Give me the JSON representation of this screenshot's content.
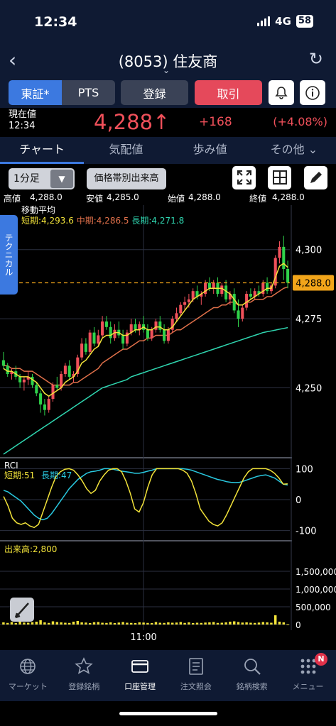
{
  "status": {
    "time": "12:34",
    "network": "4G",
    "battery": "58"
  },
  "header": {
    "title": "(8053) 住友商"
  },
  "actions": {
    "tosho": "東証*",
    "pts": "PTS",
    "register": "登録",
    "trade": "取引"
  },
  "quote": {
    "label": "現在値",
    "time": "12:34",
    "price": "4,288",
    "arrow": "↑",
    "change": "+168",
    "pct": "(+4.08%)"
  },
  "tabs": [
    "チャート",
    "気配値",
    "歩み値",
    "その他 ⌄"
  ],
  "toolbar": {
    "interval": "1分足",
    "price_band": "価格帯別出来高"
  },
  "ohlc": {
    "high_label": "高値",
    "high": "4,288.0",
    "low_label": "安値",
    "low": "4,285.0",
    "open_label": "始値",
    "open": "4,288.0",
    "close_label": "終値",
    "close": "4,288.0"
  },
  "ma": {
    "title": "移動平均",
    "short": "短期:4,293.6",
    "mid": "中期:4,286.5",
    "long": "長期:4,271.8"
  },
  "technical_label": "テクニカル",
  "rci": {
    "title": "RCI",
    "short": "短期:51",
    "long": "長期:47"
  },
  "volume": {
    "title": "出来高:2,800"
  },
  "colors": {
    "up": "#f0505a",
    "down": "#2fd24a",
    "ma_short": "#f2e33a",
    "ma_mid": "#e0704a",
    "ma_long": "#2fd6b0",
    "accent": "#3c79e0"
  },
  "chart_data": [
    {
      "type": "candlestick",
      "title": "",
      "y_ticks": [
        4300,
        4275,
        4250
      ],
      "ylim": [
        4226,
        4312
      ],
      "current_price_line": 4288.0,
      "current_price_label": "4,288.0",
      "x_tick_labels": [
        "11:00"
      ],
      "candles": [
        [
          4260,
          4263,
          4257,
          4258
        ],
        [
          4258,
          4259,
          4254,
          4255
        ],
        [
          4255,
          4257,
          4253,
          4256
        ],
        [
          4256,
          4258,
          4253,
          4254
        ],
        [
          4254,
          4255,
          4250,
          4252
        ],
        [
          4252,
          4254,
          4249,
          4253
        ],
        [
          4253,
          4256,
          4251,
          4254
        ],
        [
          4254,
          4255,
          4250,
          4251
        ],
        [
          4251,
          4252,
          4247,
          4248
        ],
        [
          4248,
          4249,
          4241,
          4244
        ],
        [
          4244,
          4246,
          4240,
          4242
        ],
        [
          4242,
          4247,
          4241,
          4246
        ],
        [
          4246,
          4252,
          4245,
          4251
        ],
        [
          4251,
          4254,
          4249,
          4250
        ],
        [
          4250,
          4256,
          4249,
          4255
        ],
        [
          4255,
          4259,
          4254,
          4258
        ],
        [
          4258,
          4260,
          4253,
          4254
        ],
        [
          4254,
          4256,
          4252,
          4255
        ],
        [
          4255,
          4262,
          4254,
          4261
        ],
        [
          4261,
          4268,
          4260,
          4266
        ],
        [
          4266,
          4268,
          4262,
          4263
        ],
        [
          4263,
          4271,
          4262,
          4270
        ],
        [
          4270,
          4272,
          4265,
          4266
        ],
        [
          4266,
          4271,
          4265,
          4269
        ],
        [
          4269,
          4276,
          4268,
          4274
        ],
        [
          4274,
          4276,
          4271,
          4272
        ],
        [
          4272,
          4274,
          4266,
          4268
        ],
        [
          4268,
          4273,
          4267,
          4271
        ],
        [
          4271,
          4274,
          4268,
          4269
        ],
        [
          4269,
          4271,
          4264,
          4266
        ],
        [
          4266,
          4271,
          4265,
          4270
        ],
        [
          4270,
          4275,
          4269,
          4273
        ],
        [
          4273,
          4275,
          4270,
          4271
        ],
        [
          4271,
          4274,
          4269,
          4273
        ],
        [
          4273,
          4276,
          4270,
          4271
        ],
        [
          4271,
          4273,
          4267,
          4268
        ],
        [
          4268,
          4272,
          4267,
          4271
        ],
        [
          4271,
          4275,
          4270,
          4274
        ],
        [
          4274,
          4276,
          4270,
          4271
        ],
        [
          4271,
          4273,
          4266,
          4267
        ],
        [
          4267,
          4272,
          4266,
          4271
        ],
        [
          4271,
          4276,
          4270,
          4275
        ],
        [
          4275,
          4279,
          4274,
          4277
        ],
        [
          4277,
          4281,
          4276,
          4280
        ],
        [
          4280,
          4283,
          4278,
          4281
        ],
        [
          4281,
          4284,
          4279,
          4282
        ],
        [
          4282,
          4286,
          4281,
          4285
        ],
        [
          4285,
          4287,
          4282,
          4283
        ],
        [
          4283,
          4285,
          4280,
          4284
        ],
        [
          4284,
          4289,
          4283,
          4288
        ],
        [
          4288,
          4290,
          4285,
          4286
        ],
        [
          4286,
          4289,
          4284,
          4288
        ],
        [
          4288,
          4290,
          4283,
          4284
        ],
        [
          4284,
          4288,
          4283,
          4287
        ],
        [
          4287,
          4289,
          4281,
          4282
        ],
        [
          4282,
          4285,
          4280,
          4284
        ],
        [
          4284,
          4286,
          4277,
          4278
        ],
        [
          4278,
          4282,
          4272,
          4275
        ],
        [
          4275,
          4280,
          4274,
          4279
        ],
        [
          4279,
          4285,
          4278,
          4284
        ],
        [
          4284,
          4286,
          4282,
          4283
        ],
        [
          4283,
          4286,
          4282,
          4285
        ],
        [
          4285,
          4287,
          4283,
          4284
        ],
        [
          4284,
          4289,
          4283,
          4288
        ],
        [
          4288,
          4290,
          4284,
          4285
        ],
        [
          4285,
          4288,
          4284,
          4287
        ],
        [
          4287,
          4298,
          4286,
          4297
        ],
        [
          4297,
          4303,
          4295,
          4301
        ],
        [
          4301,
          4305,
          4289,
          4293
        ],
        [
          4293,
          4296,
          4286,
          4288
        ]
      ],
      "ma_short": [
        4257,
        4256,
        4256,
        4255,
        4254,
        4254,
        4254,
        4253,
        4252,
        4250,
        4248,
        4247,
        4248,
        4249,
        4250,
        4252,
        4253,
        4254,
        4256,
        4259,
        4260,
        4262,
        4264,
        4265,
        4268,
        4269,
        4269,
        4270,
        4270,
        4269,
        4269,
        4270,
        4271,
        4271,
        4272,
        4271,
        4271,
        4272,
        4272,
        4271,
        4271,
        4272,
        4274,
        4276,
        4278,
        4280,
        4282,
        4283,
        4284,
        4285,
        4286,
        4286,
        4286,
        4286,
        4285,
        4284,
        4282,
        4280,
        4280,
        4281,
        4282,
        4283,
        4284,
        4285,
        4286,
        4286,
        4290,
        4294,
        4295,
        4293.6
      ],
      "ma_mid": [
        4258,
        4258,
        4257,
        4257,
        4257,
        4256,
        4256,
        4256,
        4255,
        4254,
        4253,
        4252,
        4251,
        4251,
        4251,
        4251,
        4251,
        4252,
        4252,
        4253,
        4254,
        4255,
        4256,
        4257,
        4259,
        4260,
        4261,
        4262,
        4263,
        4264,
        4264,
        4265,
        4266,
        4267,
        4267,
        4268,
        4268,
        4269,
        4269,
        4269,
        4269,
        4270,
        4271,
        4271,
        4272,
        4273,
        4274,
        4275,
        4276,
        4277,
        4278,
        4279,
        4279,
        4280,
        4280,
        4281,
        4281,
        4280,
        4280,
        4281,
        4281,
        4282,
        4282,
        4282,
        4283,
        4283,
        4284,
        4285,
        4286,
        4286.5
      ],
      "ma_long": [
        4226,
        4227,
        4228,
        4229,
        4230,
        4231,
        4232,
        4233,
        4234,
        4235,
        4236,
        4237,
        4238,
        4239,
        4240,
        4241,
        4242,
        4243,
        4244,
        4245,
        4246,
        4247,
        4248,
        4249,
        4250,
        4250.5,
        4251,
        4251.5,
        4252,
        4252.5,
        4253,
        4254,
        4254.5,
        4255,
        4255.5,
        4256,
        4256.5,
        4257,
        4257.5,
        4258,
        4258.5,
        4259,
        4259.5,
        4260,
        4260.5,
        4261,
        4261.5,
        4262,
        4262.5,
        4263,
        4263.5,
        4264,
        4264.5,
        4265,
        4265.5,
        4266,
        4266.5,
        4267,
        4267.5,
        4268,
        4268.5,
        4269,
        4269.5,
        4270,
        4270.3,
        4270.6,
        4270.9,
        4271.2,
        4271.5,
        4271.8
      ]
    },
    {
      "type": "line",
      "title": "RCI",
      "y_ticks": [
        100,
        0,
        -100
      ],
      "ylim": [
        -110,
        110
      ],
      "series": [
        {
          "name": "短期",
          "values": [
            10,
            -20,
            -60,
            -75,
            -80,
            -75,
            -85,
            -90,
            -80,
            -40,
            0,
            40,
            75,
            90,
            98,
            100,
            95,
            80,
            60,
            35,
            20,
            30,
            60,
            80,
            95,
            100,
            100,
            90,
            60,
            20,
            -30,
            -40,
            -10,
            40,
            80,
            100,
            100,
            100,
            100,
            100,
            100,
            95,
            85,
            60,
            20,
            -30,
            -50,
            -70,
            -80,
            -85,
            -75,
            -50,
            -20,
            10,
            40,
            70,
            90,
            100,
            100,
            100,
            100,
            95,
            85,
            70,
            50,
            51
          ]
        },
        {
          "name": "長期",
          "values": [
            30,
            25,
            15,
            5,
            -5,
            -20,
            -35,
            -50,
            -60,
            -65,
            -60,
            -45,
            -25,
            -5,
            15,
            35,
            50,
            65,
            75,
            85,
            90,
            92,
            95,
            100,
            100,
            98,
            95,
            92,
            90,
            88,
            85,
            85,
            88,
            92,
            95,
            100,
            100,
            100,
            100,
            100,
            100,
            100,
            98,
            95,
            90,
            85,
            80,
            75,
            70,
            65,
            62,
            58,
            56,
            55,
            56,
            60,
            65,
            70,
            75,
            78,
            80,
            75,
            70,
            60,
            50,
            47
          ]
        }
      ]
    },
    {
      "type": "bar",
      "title": "出来高",
      "y_ticks": [
        "1,500,000",
        "1,000,000",
        "500,000",
        "0"
      ],
      "ylim": [
        0,
        1800000
      ],
      "values": [
        60000,
        45000,
        70000,
        40000,
        90000,
        55000,
        50000,
        65000,
        80000,
        120000,
        60000,
        45000,
        90000,
        70000,
        60000,
        50000,
        45000,
        80000,
        100000,
        60000,
        55000,
        40000,
        65000,
        70000,
        50000,
        45000,
        60000,
        40000,
        55000,
        70000,
        50000,
        45000,
        40000,
        60000,
        55000,
        45000,
        40000,
        70000,
        50000,
        45000,
        60000,
        50000,
        55000,
        70000,
        45000,
        60000,
        40000,
        50000,
        45000,
        55000,
        60000,
        70000,
        45000,
        50000,
        60000,
        80000,
        90000,
        70000,
        55000,
        60000,
        50000,
        45000,
        55000,
        70000,
        60000,
        50000,
        260000,
        80000,
        60000,
        2800
      ]
    }
  ]
}
